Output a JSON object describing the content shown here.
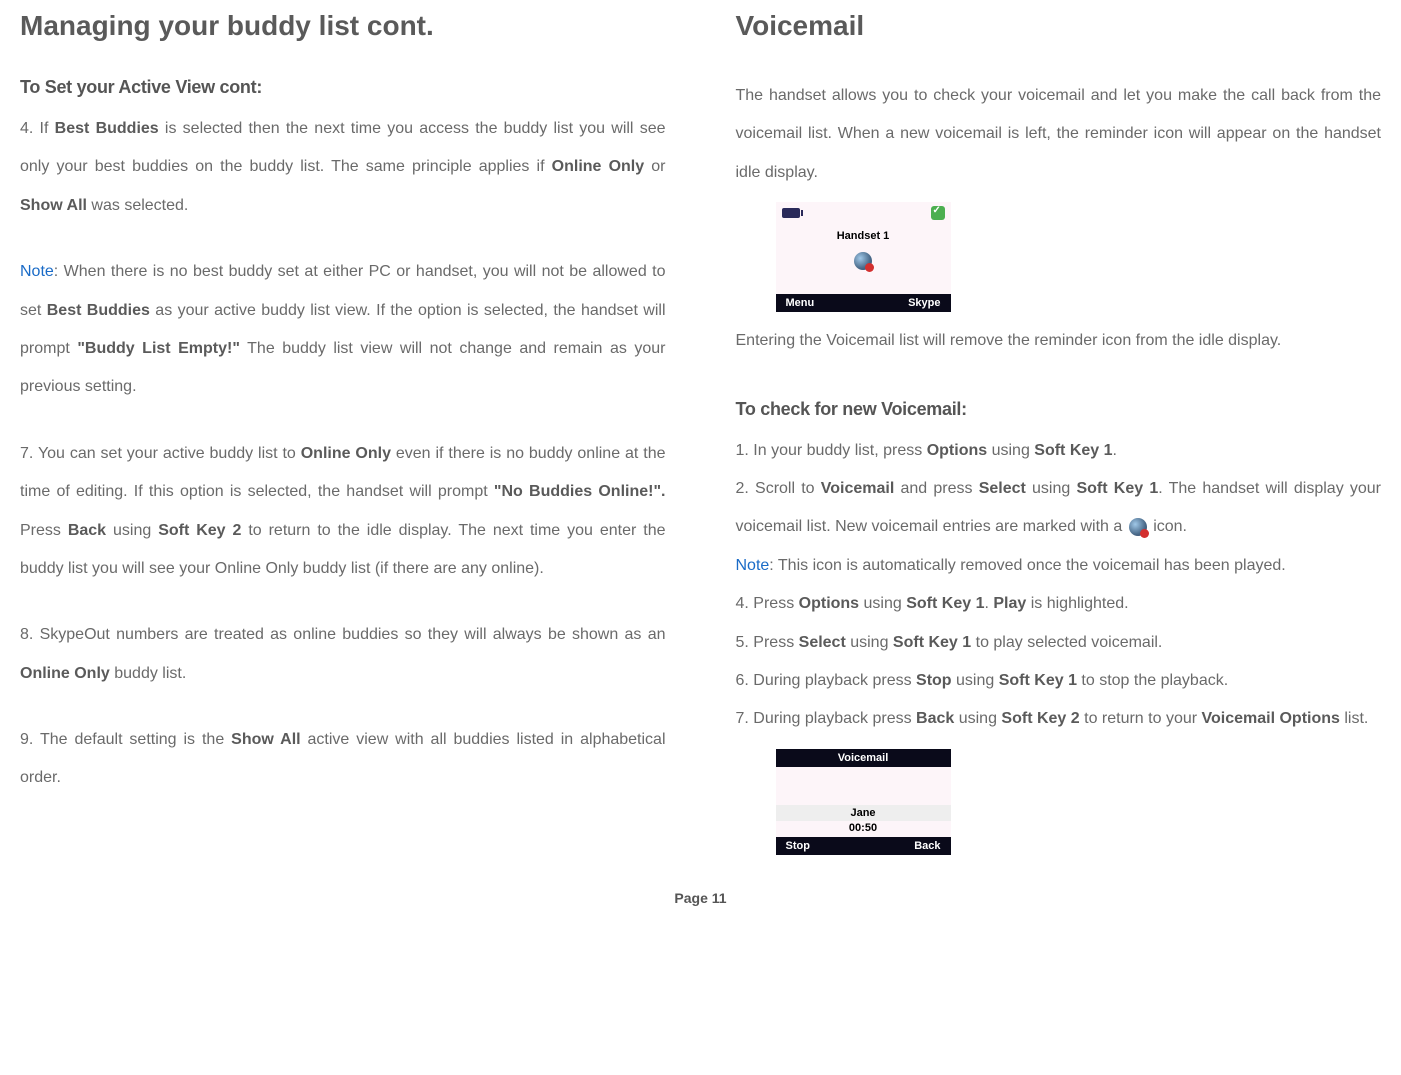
{
  "left": {
    "title": "Managing your buddy list cont.",
    "h2": "To Set your Active View cont:",
    "p1_a": "4. If ",
    "p1_b1": "Best Buddies",
    "p1_c": " is selected then the next time you access the buddy list you will see only your best buddies on the buddy list. The same principle applies if ",
    "p1_b2": "Online Only",
    "p1_d": " or ",
    "p1_b3": "Show All",
    "p1_e": " was selected.",
    "p2_note": "Note",
    "p2_a": ": When there is no best buddy set at either PC or handset, you will not be allowed to set ",
    "p2_b1": "Best Buddies",
    "p2_b": " as your active buddy list view. If the option is selected, the handset will prompt ",
    "p2_b2": "\"Buddy List Empty!\"",
    "p2_c": " The buddy list view will not change and remain as your previous setting.",
    "p3_a": "7. You can set your active buddy list to ",
    "p3_b1": "Online Only",
    "p3_b": " even if there is no buddy online at the time of editing.  If this option is selected, the handset will prompt ",
    "p3_b2": "\"No Buddies Online!\".",
    "p3_c": " Press ",
    "p3_b3": "Back",
    "p3_d": " using ",
    "p3_b4": "Soft Key 2",
    "p3_e": " to return to the idle display.  The next time you enter the buddy list you will see your Online Only buddy list (if there are any online).",
    "p4_a": "8. SkypeOut numbers are treated as online buddies so they will always be shown as an ",
    "p4_b1": "Online Only",
    "p4_b": " buddy list.",
    "p5_a": "9. The default setting is the ",
    "p5_b1": "Show All",
    "p5_b": " active view with all buddies listed in alphabetical order."
  },
  "right": {
    "title": "Voicemail",
    "p1": "The handset allows you to check your voicemail and let you make the call back from the voicemail list.  When a new voicemail is left, the reminder icon will appear on the handset idle display.",
    "screen1": {
      "handset": "Handset    1",
      "menu": "Menu",
      "skype": "Skype"
    },
    "p2": " Entering the Voicemail list will remove the reminder icon from the idle display.",
    "h2": "To check for new Voicemail:",
    "s1_a": "1. In your buddy list, press ",
    "s1_b1": "Options",
    "s1_b": " using ",
    "s1_b2": "Soft Key 1",
    "s1_c": ".",
    "s2_a": "2. Scroll to ",
    "s2_b1": "Voicemail",
    "s2_b": " and press ",
    "s2_b2": "Select",
    "s2_c": " using ",
    "s2_b3": "Soft Key 1",
    "s2_d": ". The handset will display your voicemail list.  New voicemail entries are marked with a ",
    "s2_e": " icon.",
    "s3_note": "Note",
    "s3_a": ": This icon is automatically removed once the voicemail has been played.",
    "s4_a": "4. Press ",
    "s4_b1": "Options",
    "s4_b": " using ",
    "s4_b2": "Soft Key 1",
    "s4_c": ". ",
    "s4_b3": "Play",
    "s4_d": " is highlighted.",
    "s5_a": "5. Press ",
    "s5_b1": "Select",
    "s5_b": " using ",
    "s5_b2": "Soft Key 1",
    "s5_c": " to play selected voicemail.",
    "s6_a": "6. During playback press ",
    "s6_b1": "Stop",
    "s6_b": " using ",
    "s6_b2": "Soft Key 1",
    "s6_c": " to stop the playback.",
    "s7_a": "7. During playback press ",
    "s7_b1": "Back",
    "s7_b": " using ",
    "s7_b2": "Soft Key 2",
    "s7_c": " to return to your ",
    "s7_b3": "Voicemail Options",
    "s7_d": " list.",
    "screen2": {
      "title": "Voicemail",
      "name": "Jane",
      "time": "00:50",
      "stop": "Stop",
      "back": "Back"
    }
  },
  "page": "Page 11"
}
